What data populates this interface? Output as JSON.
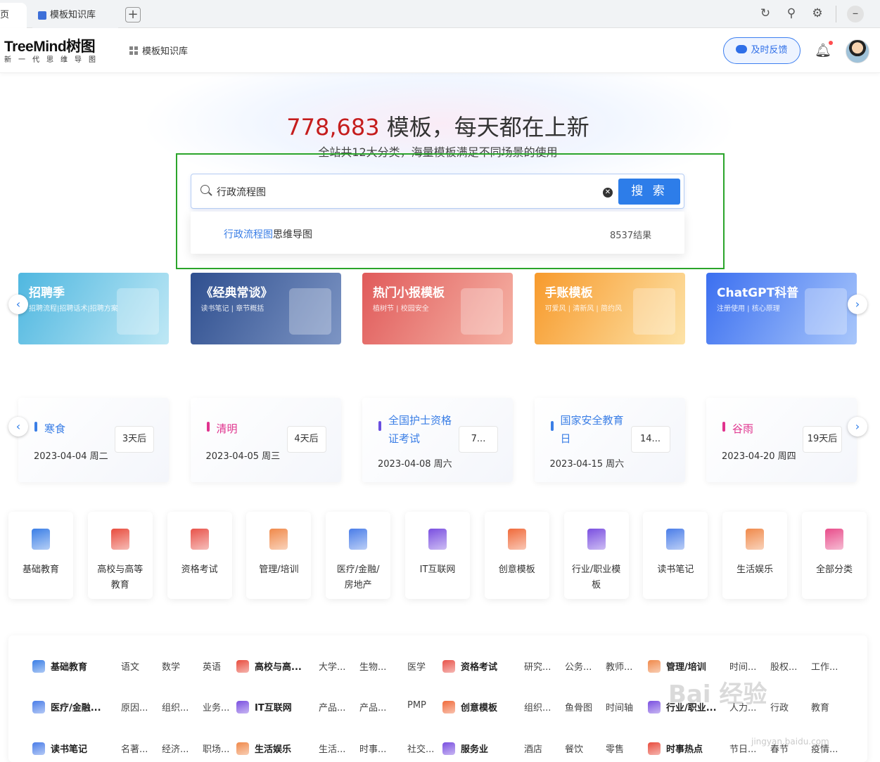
{
  "browser": {
    "prev_tab_label": "页",
    "active_tab_label": "模板知识库",
    "new_tab": "+"
  },
  "header": {
    "logo": "TreeMind树图",
    "logo_sub": "新一代思维导图",
    "nav_link": "模板知识库",
    "feedback": "及时反馈"
  },
  "hero": {
    "count": "778,683",
    "title_rest": " 模板，每天都在上新",
    "subtitle": "全站共12大分类，海量模板满足不同场景的使用",
    "search_value": "行政流程图",
    "search_button": "搜 索",
    "suggestion_highlight": "行政流程图",
    "suggestion_rest": "思维导图",
    "suggestion_count": "8537结果"
  },
  "banners": [
    {
      "title": "招聘季",
      "sub": "招聘流程|招聘话术|招聘方案",
      "color_a": "#4fb7e0",
      "color_b": "#bfe8f5"
    },
    {
      "title": "《经典常谈》",
      "sub": "读书笔记 | 章节概括",
      "color_a": "#2f4f8f",
      "color_b": "#7d95c4"
    },
    {
      "title": "热门小报模板",
      "sub": "植树节 | 校园安全",
      "color_a": "#e05a5a",
      "color_b": "#f6b4a6"
    },
    {
      "title": "手账模板",
      "sub": "可爱风 | 清新风 | 简约风",
      "color_a": "#f79a2c",
      "color_b": "#fde3a8"
    },
    {
      "title": "ChatGPT科普",
      "sub": "注册使用 | 核心原理",
      "color_a": "#3b6ff0",
      "color_b": "#a9c7fb"
    }
  ],
  "holidays": [
    {
      "name": "寒食",
      "date": "2023-04-04 周二",
      "badge": "3天后",
      "color": "#3a7ee6",
      "bar": "#3a7ee6"
    },
    {
      "name": "清明",
      "date": "2023-04-05 周三",
      "badge": "4天后",
      "color": "#e0338e",
      "bar": "#e0338e"
    },
    {
      "name": "全国护士资格证考试",
      "date": "2023-04-08 周六",
      "badge": "7...",
      "color": "#3a7ee6",
      "bar": "#6a4fe0"
    },
    {
      "name": "国家安全教育日",
      "date": "2023-04-15 周六",
      "badge": "14...",
      "color": "#3a7ee6",
      "bar": "#3a7ee6"
    },
    {
      "name": "谷雨",
      "date": "2023-04-20 周四",
      "badge": "19天后",
      "color": "#e0338e",
      "bar": "#e0338e"
    }
  ],
  "categories": [
    {
      "label": "基础教育",
      "color": "#3a7ee6"
    },
    {
      "label": "高校与高等教育",
      "color": "#e84c3d"
    },
    {
      "label": "资格考试",
      "color": "#e8534a"
    },
    {
      "label": "管理/培训",
      "color": "#f0894a"
    },
    {
      "label": "医疗/金融/房地产",
      "color": "#4a7de8"
    },
    {
      "label": "IT互联网",
      "color": "#7a4fe0"
    },
    {
      "label": "创意模板",
      "color": "#f06a3a"
    },
    {
      "label": "行业/职业模板",
      "color": "#7a4fe0"
    },
    {
      "label": "读书笔记",
      "color": "#4a7de8"
    },
    {
      "label": "生活娱乐",
      "color": "#f0894a"
    },
    {
      "label": "全部分类",
      "color": "#e84c8a"
    }
  ],
  "panel_rows": [
    {
      "items": [
        {
          "t": "基础教育",
          "head": true,
          "c": "#3a7ee6"
        },
        {
          "t": "语文"
        },
        {
          "t": "数学"
        },
        {
          "t": "英语"
        },
        {
          "t": "高校与高...",
          "head": true,
          "c": "#e84c3d"
        },
        {
          "t": "大学..."
        },
        {
          "t": "生物..."
        },
        {
          "t": "医学"
        },
        {
          "t": "资格考试",
          "head": true,
          "c": "#e8534a"
        },
        {
          "t": "研究..."
        },
        {
          "t": "公务..."
        },
        {
          "t": "教师..."
        },
        {
          "t": "管理/培训",
          "head": true,
          "c": "#f0894a"
        },
        {
          "t": "时间..."
        },
        {
          "t": "股权..."
        },
        {
          "t": "工作..."
        }
      ]
    },
    {
      "items": [
        {
          "t": "医疗/金融...",
          "head": true,
          "c": "#4a7de8"
        },
        {
          "t": "原因..."
        },
        {
          "t": "组织..."
        },
        {
          "t": "业务..."
        },
        {
          "t": "IT互联网",
          "head": true,
          "c": "#7a4fe0"
        },
        {
          "t": "产品..."
        },
        {
          "t": "产品..."
        },
        {
          "t": "PMP"
        },
        {
          "t": "创意模板",
          "head": true,
          "c": "#f06a3a"
        },
        {
          "t": "组织..."
        },
        {
          "t": "鱼骨图"
        },
        {
          "t": "时间轴"
        },
        {
          "t": "行业/职业...",
          "head": true,
          "c": "#7a4fe0"
        },
        {
          "t": "人力..."
        },
        {
          "t": "行政"
        },
        {
          "t": "教育"
        }
      ]
    },
    {
      "items": [
        {
          "t": "读书笔记",
          "head": true,
          "c": "#4a7de8"
        },
        {
          "t": "名著..."
        },
        {
          "t": "经济..."
        },
        {
          "t": "职场..."
        },
        {
          "t": "生活娱乐",
          "head": true,
          "c": "#f0894a"
        },
        {
          "t": "生活..."
        },
        {
          "t": "时事..."
        },
        {
          "t": "社交..."
        },
        {
          "t": "服务业",
          "head": true,
          "c": "#7a4fe0"
        },
        {
          "t": "酒店"
        },
        {
          "t": "餐饮"
        },
        {
          "t": "零售"
        },
        {
          "t": "时事热点",
          "head": true,
          "c": "#e84c3d"
        },
        {
          "t": "节日..."
        },
        {
          "t": "春节"
        },
        {
          "t": "疫情..."
        }
      ]
    }
  ],
  "watermark": "Bai 经验",
  "watermark_url": "jingyan.baidu.com"
}
